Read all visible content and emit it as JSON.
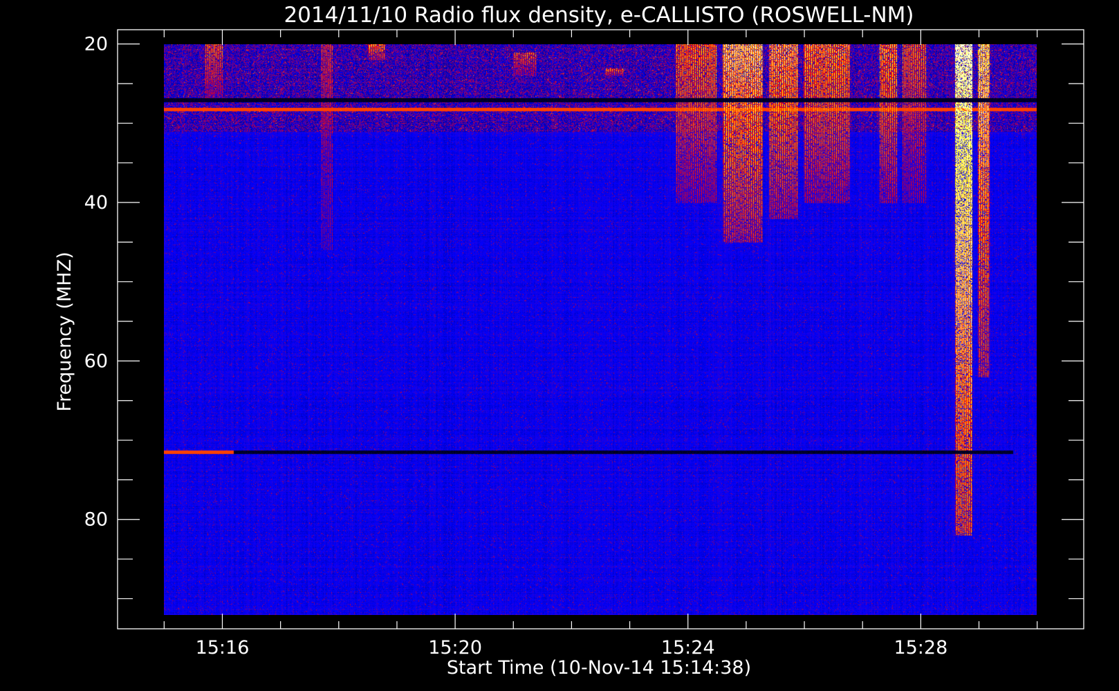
{
  "chart_data": {
    "type": "heatmap",
    "title": "2014/11/10  Radio flux density, e-CALLISTO (ROSWELL-NM)",
    "xlabel": "Start Time (10-Nov-14 15:14:38)",
    "ylabel": "Frequency (MHZ)",
    "x_range_minutes": [
      15.0,
      30.0
    ],
    "x_axis_limits_minutes": [
      14.2,
      30.8
    ],
    "x_ticks": [
      {
        "minute": 16,
        "label": "15:16"
      },
      {
        "minute": 20,
        "label": "15:20"
      },
      {
        "minute": 24,
        "label": "15:24"
      },
      {
        "minute": 28,
        "label": "15:28"
      }
    ],
    "x_minor_tick_step_minutes": 1,
    "y_range_mhz": [
      20,
      92
    ],
    "y_axis_limits_mhz": [
      18.2,
      93.8
    ],
    "y_inverted": true,
    "y_ticks": [
      {
        "mhz": 20,
        "label": "20"
      },
      {
        "mhz": 40,
        "label": "40"
      },
      {
        "mhz": 60,
        "label": "60"
      },
      {
        "mhz": 80,
        "label": "80"
      }
    ],
    "y_minor_tick_step_mhz": 5,
    "colormap": [
      "#000000",
      "#0000ff",
      "#ff0000",
      "#ffff00",
      "#ffffff"
    ],
    "background_level": 0.28,
    "bursts": [
      {
        "t0": 15.7,
        "t1": 16.0,
        "f0": 20,
        "f1": 27,
        "intensity": 0.55
      },
      {
        "t0": 17.7,
        "t1": 17.9,
        "f0": 20,
        "f1": 46,
        "intensity": 0.45
      },
      {
        "t0": 18.5,
        "t1": 18.8,
        "f0": 20,
        "f1": 22,
        "intensity": 0.65
      },
      {
        "t0": 21.0,
        "t1": 21.4,
        "f0": 21,
        "f1": 24,
        "intensity": 0.55
      },
      {
        "t0": 22.6,
        "t1": 22.9,
        "f0": 23,
        "f1": 24,
        "intensity": 0.6
      },
      {
        "t0": 23.8,
        "t1": 24.5,
        "f0": 20,
        "f1": 40,
        "intensity": 0.6
      },
      {
        "t0": 24.6,
        "t1": 25.3,
        "f0": 20,
        "f1": 45,
        "intensity": 0.75
      },
      {
        "t0": 25.4,
        "t1": 25.9,
        "f0": 20,
        "f1": 42,
        "intensity": 0.7
      },
      {
        "t0": 26.0,
        "t1": 26.8,
        "f0": 20,
        "f1": 40,
        "intensity": 0.65
      },
      {
        "t0": 27.3,
        "t1": 27.6,
        "f0": 20,
        "f1": 40,
        "intensity": 0.65
      },
      {
        "t0": 27.7,
        "t1": 28.1,
        "f0": 20,
        "f1": 40,
        "intensity": 0.55
      },
      {
        "t0": 28.6,
        "t1": 28.9,
        "f0": 20,
        "f1": 82,
        "intensity": 0.95
      },
      {
        "t0": 29.0,
        "t1": 29.2,
        "f0": 20,
        "f1": 62,
        "intensity": 0.8
      }
    ],
    "horizontal_lines": [
      {
        "f": 27.0,
        "kind": "dark",
        "t0": 15.0,
        "t1": 30.0
      },
      {
        "f": 28.2,
        "kind": "red",
        "t0": 15.0,
        "t1": 30.0
      },
      {
        "f": 71.5,
        "kind": "dark",
        "t0": 15.0,
        "t1": 29.6
      },
      {
        "f": 71.5,
        "kind": "red",
        "t0": 15.0,
        "t1": 16.2
      }
    ]
  }
}
